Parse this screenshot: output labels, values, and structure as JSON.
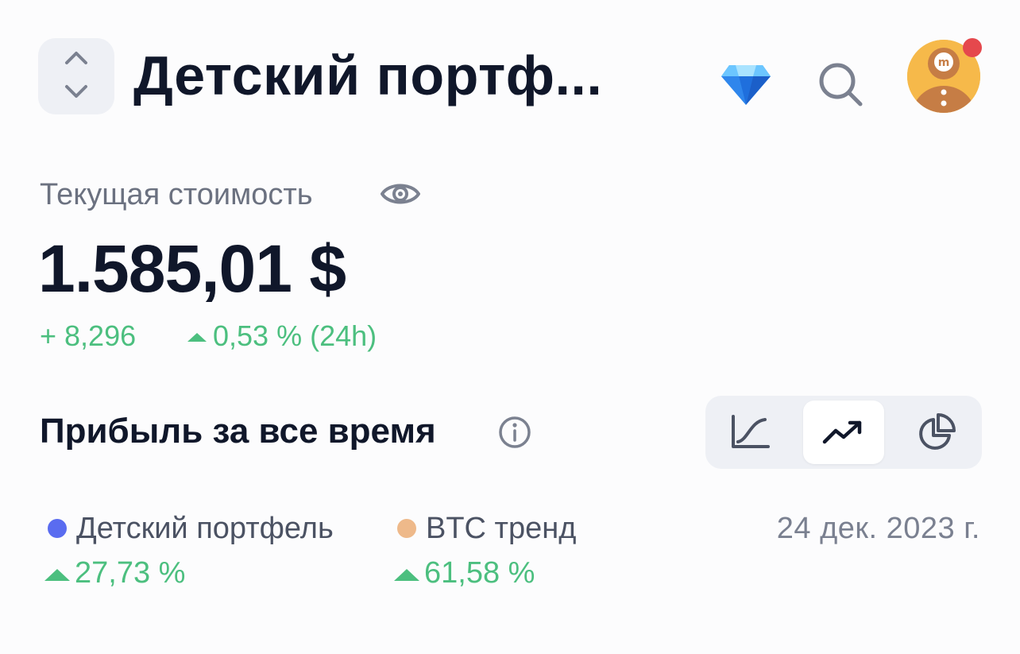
{
  "header": {
    "title": "Детский портф...",
    "switcher_icon": "chevron-up-down-icon",
    "premium_icon": "diamond-icon",
    "search_icon": "search-icon",
    "avatar_icon": "gingerbread-avatar",
    "notification": true
  },
  "portfolio": {
    "current_value_label": "Текущая стоимость",
    "visibility_icon": "eye-icon",
    "value": "1.585,01 $",
    "change_abs": "+ 8,296",
    "change_pct": "0,53 % (24h)"
  },
  "profit": {
    "title": "Прибыль за все время",
    "info_icon": "info-icon",
    "views": [
      {
        "icon": "line-chart-icon",
        "active": false
      },
      {
        "icon": "trend-up-icon",
        "active": true
      },
      {
        "icon": "pie-chart-icon",
        "active": false
      }
    ]
  },
  "legend": {
    "items": [
      {
        "label": "Детский портфель",
        "pct": "27,73 %",
        "color": "#5a6cf0"
      },
      {
        "label": "BTC тренд",
        "pct": "61,58 %",
        "color": "#eeb98a"
      }
    ],
    "date": "24 дек. 2023 г."
  },
  "colors": {
    "positive": "#4cbf7f",
    "title": "#10172a",
    "muted": "#6b7180",
    "segment_bg": "#eef0f5"
  }
}
